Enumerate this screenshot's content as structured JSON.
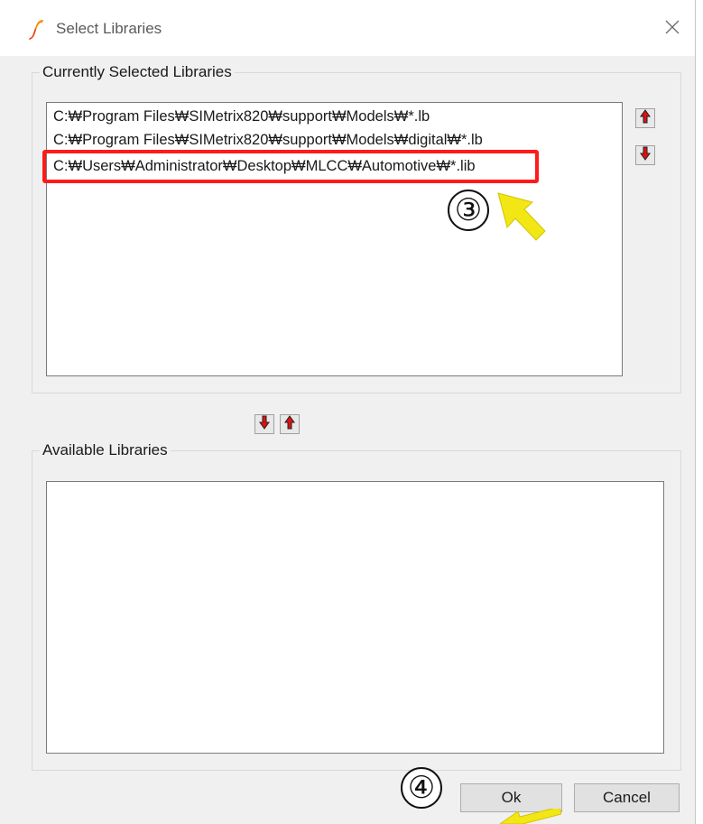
{
  "window": {
    "title": "Select Libraries",
    "close_icon": "close-icon",
    "app_icon": "simetrix-logo-icon"
  },
  "selected_group": {
    "legend": "Currently Selected Libraries",
    "items": [
      "C:₩Program Files₩SIMetrix820₩support₩Models₩*.lb",
      "C:₩Program Files₩SIMetrix820₩support₩Models₩digital₩*.lb",
      "C:₩Users₩Administrator₩Desktop₩MLCC₩Automotive₩*.lib"
    ],
    "highlighted_index": 2,
    "move_up_icon": "arrow-up-icon",
    "move_down_icon": "arrow-down-icon"
  },
  "transfer": {
    "remove_icon": "arrow-down-icon",
    "add_icon": "arrow-up-icon"
  },
  "available_group": {
    "legend": "Available Libraries",
    "items": []
  },
  "buttons": {
    "ok": "Ok",
    "cancel": "Cancel"
  },
  "annotations": {
    "step3": "③",
    "step4": "④",
    "highlight_color": "#ff1a1a",
    "pointer_color": "#f2e614"
  }
}
